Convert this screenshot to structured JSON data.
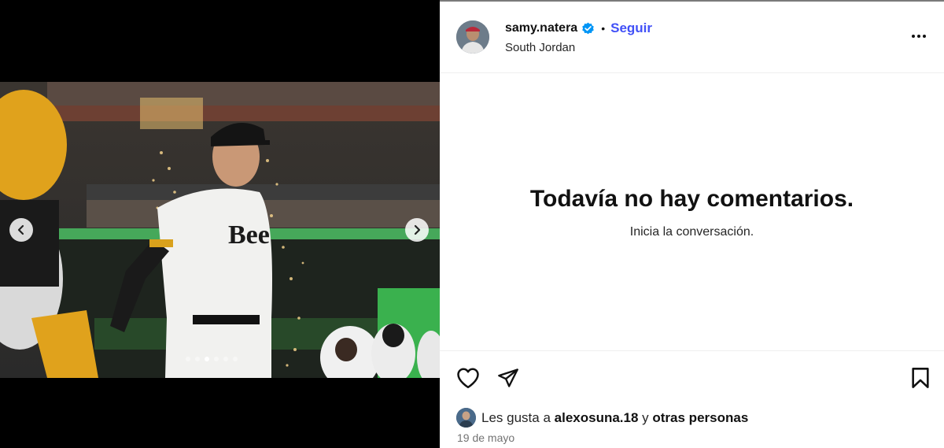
{
  "post": {
    "username": "samy.natera",
    "separator": "•",
    "follow_label": "Seguir",
    "location": "South Jordan",
    "empty_title": "Todavía no hay comentarios.",
    "empty_subtitle": "Inicia la conversación.",
    "likes_prefix": "Les gusta a",
    "likes_user": "alexosuna.18",
    "likes_conjunction": "y",
    "likes_others": "otras personas",
    "date": "19 de mayo"
  },
  "carousel": {
    "current_index": 3,
    "total": 6
  },
  "icons": {
    "verified": "verified-badge-icon",
    "more": "more-options-icon",
    "like": "heart-icon",
    "share": "send-icon",
    "save": "bookmark-icon",
    "prev": "chevron-left-icon",
    "next": "chevron-right-icon"
  },
  "colors": {
    "accent": "#4150f7",
    "verified": "#0095f6"
  }
}
